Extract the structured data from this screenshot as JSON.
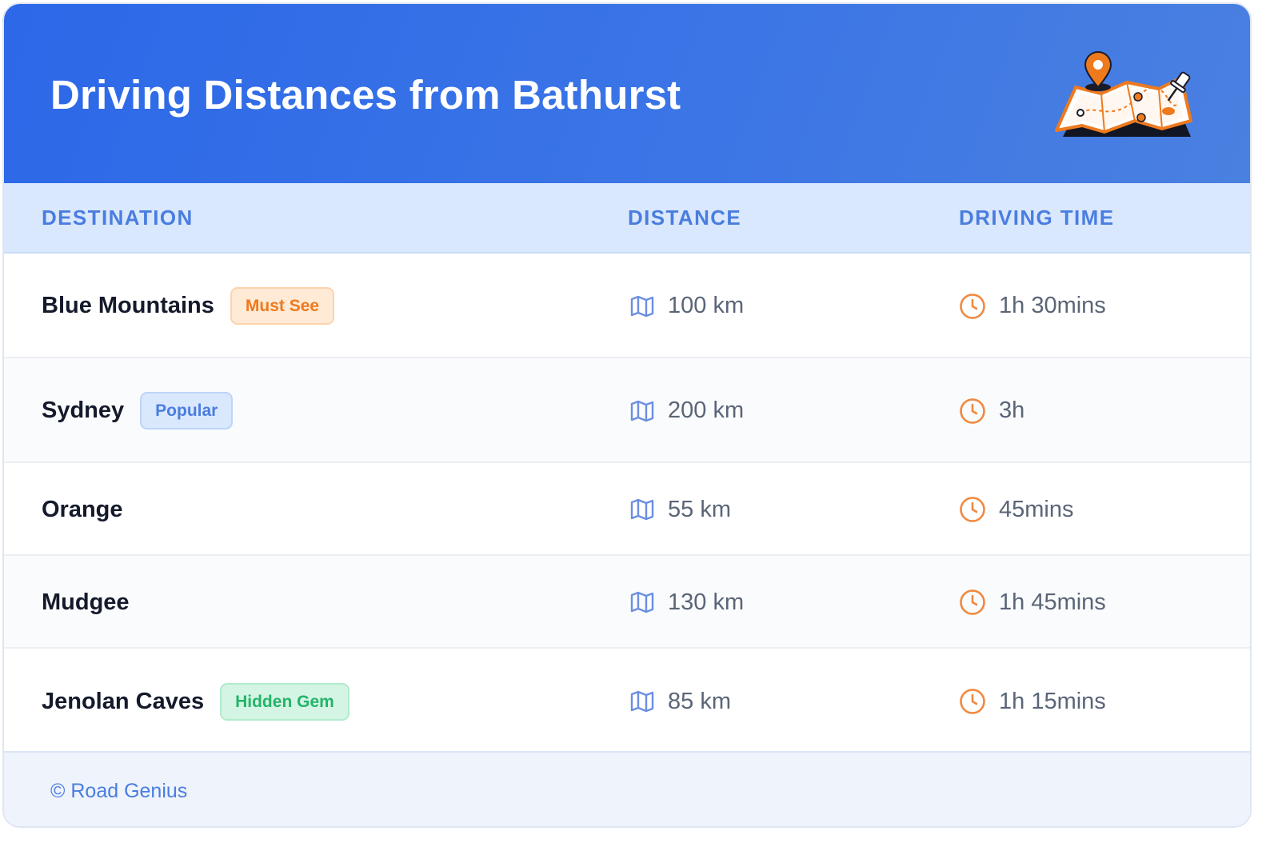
{
  "title": "Driving Distances from Bathurst",
  "header_icon": "map-with-pins-illustration",
  "columns": {
    "destination": "DESTINATION",
    "distance": "DISTANCE",
    "time": "DRIVING TIME"
  },
  "rows": [
    {
      "destination": "Blue Mountains",
      "badge": "Must See",
      "badge_type": "orange",
      "distance": "100 km",
      "time": "1h 30mins"
    },
    {
      "destination": "Sydney",
      "badge": "Popular",
      "badge_type": "blue",
      "distance": "200 km",
      "time": "3h"
    },
    {
      "destination": "Orange",
      "badge": null,
      "badge_type": null,
      "distance": "55 km",
      "time": "45mins"
    },
    {
      "destination": "Mudgee",
      "badge": null,
      "badge_type": null,
      "distance": "130 km",
      "time": "1h 45mins"
    },
    {
      "destination": "Jenolan Caves",
      "badge": "Hidden Gem",
      "badge_type": "green",
      "distance": "85 km",
      "time": "1h 15mins"
    }
  ],
  "footer": "© Road Genius",
  "icons": {
    "distance": "map-icon",
    "time": "clock-icon"
  },
  "colors": {
    "header": "#2c68e8",
    "accent_blue": "#4a7de0",
    "accent_orange": "#f0883e",
    "badge_orange": {
      "bg": "#feead5",
      "border": "#fbd3ad",
      "text": "#ee7a1e"
    },
    "badge_blue": {
      "bg": "#dae8fd",
      "border": "#bdd4f9",
      "text": "#4a7de0"
    },
    "badge_green": {
      "bg": "#d4f5e3",
      "border": "#b1ebcb",
      "text": "#23b46a"
    }
  }
}
